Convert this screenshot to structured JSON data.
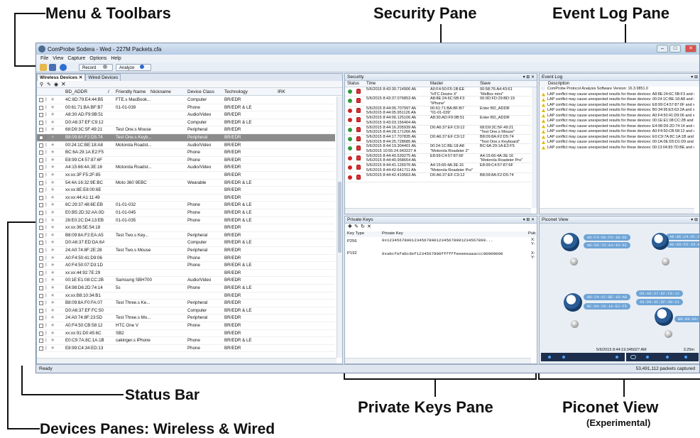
{
  "callouts": {
    "menu": "Menu & Toolbars",
    "security": "Security Pane",
    "eventlog": "Event Log Pane",
    "status": "Status Bar",
    "privkeys": "Private Keys Pane",
    "piconet": "Piconet View",
    "piconet_sub": "(Experimental)",
    "devices": "Devices Panes: Wireless & Wired"
  },
  "window": {
    "title": "ComProbe Sodera - Wed - 227M Packets.cfa",
    "min": "–",
    "max": "□",
    "close": "✕"
  },
  "menu": [
    "File",
    "View",
    "Capture",
    "Options",
    "Help"
  ],
  "toolbar": {
    "record": "Record",
    "analyze": "Analyze"
  },
  "devices": {
    "tabs": [
      "Wireless Devices ✕",
      "Wired Devices"
    ],
    "columns": [
      "BD_ADDR",
      "/",
      "Friendly Name",
      "Nickname",
      "Device Class",
      "Technology",
      "IRK"
    ],
    "rows": [
      [
        "4C:8D:79:E4:44:B5",
        "FTE.s MacBook...",
        "Computer",
        "BR/EDR"
      ],
      [
        "00:61:71:BA:BF:B7",
        "01-01-039",
        "Phone",
        "BR/EDR & LE"
      ],
      [
        "A8:30:AD:F9:9B:51",
        "",
        "Audio/Video",
        "BR/EDR"
      ],
      [
        "D0:A6:37:EF:C9:12",
        "",
        "Computer",
        "BR/EDR & LE"
      ],
      [
        "68:D9:3C:5F:49:21",
        "Test One.s Mouse",
        "Peripheral",
        "BR/EDR"
      ],
      [
        "B8:09:8A:F2:D5:74",
        "Test One.s Keyb...",
        "Peripheral",
        "BR/EDR"
      ],
      [
        "00:24:1C:BE:18:A8",
        "Motorola Roadst...",
        "Audio/Video",
        "BR/EDR"
      ],
      [
        "BC:6A:29:1A:E2:F5",
        "",
        "Phone",
        "BR/EDR"
      ],
      [
        "E8:99:C4:57:87:6F",
        "",
        "Phone",
        "BR/EDR"
      ],
      [
        "A4:15:66:4A:3E:16",
        "Motorola Roadst...",
        "Audio/Video",
        "BR/EDR"
      ],
      [
        "xx:xx:3F:F5:2F:85",
        "",
        "",
        "BR/EDR"
      ],
      [
        "54:4A:16:32:9E:BC",
        "Moto 360 9EBC",
        "Wearable",
        "BR/EDR & LE"
      ],
      [
        "xx:xx:8E:E8:00:6E",
        "",
        "",
        "BR/EDR"
      ],
      [
        "xx:xx:44:A1:11:49",
        "",
        "",
        "BR/EDR"
      ],
      [
        "8C:29:37:48:6E:EB",
        "01-01-032",
        "Phone",
        "BR/EDR & LE"
      ],
      [
        "E0:B5:2D:32:AA:0D",
        "01-01-045",
        "Phone",
        "BR/EDR & LE"
      ],
      [
        "28:E0:2C:D4:13:EB",
        "01-01-035",
        "Phone",
        "BR/EDR & LE"
      ],
      [
        "xx:xx:36:5E:54:18",
        "",
        "",
        "BR/EDR"
      ],
      [
        "B8:09:8A:F2:EA:A5",
        "Test Two.s Key...",
        "Peripheral",
        "BR/EDR"
      ],
      [
        "D0:A6:37:ED:DA:6A",
        "",
        "Computer",
        "BR/EDR & LE"
      ],
      [
        "24:A0:74:8F:2E:28",
        "Test Two.s Mouse",
        "Peripheral",
        "BR/EDR"
      ],
      [
        "A0:F4:50:41:D9:06",
        "",
        "Phone",
        "BR/EDR"
      ],
      [
        "A0:F4:50:07:D3:1D",
        "",
        "Phone",
        "BR/EDR & LE"
      ],
      [
        "xx:xx:44:92:7E:29",
        "",
        "",
        "BR/EDR"
      ],
      [
        "00:1E:E1:08:CC:2B",
        "Samsung SBH700",
        "Audio/Video",
        "BR/EDR"
      ],
      [
        "E4:98:D6:2D:74:14",
        "5s",
        "Phone",
        "BR/EDR & LE"
      ],
      [
        "xx:xx:B8:10:34:B1",
        "",
        "",
        "BR/EDR"
      ],
      [
        "B8:09:8A:F0:FA:07",
        "Test Three.s Ke...",
        "Peripheral",
        "BR/EDR"
      ],
      [
        "D0:A6:37:EF:FC:50",
        "",
        "Computer",
        "BR/EDR & LE"
      ],
      [
        "24:A0:74:8F:23:5D",
        "Test Three.s Mo...",
        "Peripheral",
        "BR/EDR"
      ],
      [
        "A0:F4:50:CB:58:12",
        "HTC One V",
        "Phone",
        "BR/EDR"
      ],
      [
        "xx:xx:91:D0:45:6C",
        "SB2",
        "",
        "BR/EDR"
      ],
      [
        "E0:C9:7A:8C:1A:1B",
        "cakinger.s iPhone",
        "Phone",
        "BR/EDR & LE"
      ],
      [
        "E8:99:C4:34:ED:13",
        "",
        "Phone",
        "BR/EDR"
      ]
    ]
  },
  "security": {
    "title": "Security",
    "columns": [
      "Status",
      "Time",
      "Master",
      "Slave"
    ],
    "rows": [
      [
        "5/6/2015 8:43:30.714906 AM",
        "",
        "A0:F4:50:F5:1B:EE",
        "\"HTC Desire X\"",
        "00:58:76:A4:43:61",
        "\"MsBox mini\""
      ],
      [
        "5/6/2015 8:43:37.076853 AM",
        "",
        "A8:8E:24:6C:5B:F3",
        "\"iPhone\"",
        "00:0D:FD:29:BD:19",
        ""
      ],
      [
        "5/6/2015 8:44:05.707997 AM",
        "5/6/2015 8:44:05.951126 AM",
        "00:61:71:BA:BF:B7",
        "\"01-01-039\"",
        "Enter BD_ADDR",
        ""
      ],
      [
        "5/6/2015 8:44:06.125106 AM",
        "5/6/2015 9:43:03.156404 AM",
        "A8:30:AD:F9:9B:51",
        "",
        "Enter BD_ADDR",
        ""
      ],
      [
        "5/6/2015 8:44:16.205939 AM",
        "5/6/2015 8:44:28.171266 AM",
        "D0:A6:37:EF:C9:12",
        "",
        "68:D9:3C:5F:49:21",
        "\"Test One.s Mouse\""
      ],
      [
        "5/6/2015 8:44:17.707835 AM",
        "5/6/2015 8:44:25.728685 AM",
        "D0:A6:37:EF:C9:12",
        "",
        "B8:09:8A:F2:D5:74",
        "\"Test One.s Keyboard\""
      ],
      [
        "5/6/2015 8:44:19.304401 AM",
        "5/6/2015 10:55:24.943227 AM",
        "00:24:1C:BE:18:A8",
        "\"Motorola Roadster 2\"",
        "BC:6A:29:1A:E2:F5",
        ""
      ],
      [
        "5/6/2015 8:44:40.539275 AM",
        "5/6/2015 8:44:40.958654 AM",
        "E8:99:C4:57:87:6F",
        "",
        "A4:15:66:4A:3E:16",
        "\"Motorola Roadster Pro\""
      ],
      [
        "5/6/2015 8:44:41.126076 AM",
        "5/6/2015 8:44:42.641711 AM",
        "A4:15:66:4A:3E:16",
        "\"Motorola Roadster Pro\"",
        "E8:99:C4:57:87:6F",
        ""
      ],
      [
        "5/6/2015 8:44:42.419563 AM",
        "",
        "D0:A6:37:EF:C9:12",
        "",
        "B8:09:8A:F2:D5:74",
        ""
      ]
    ]
  },
  "eventlog": {
    "title": "Event Log",
    "column": "Description",
    "version": "ComProbe Protocol Analysis Software Version: 16.3.9851.0",
    "prefix": "LAP conflict may cause unexpected results for these devices: ",
    "items": [
      "A8:8E:24:6C:5B:F3 and xx:xx",
      "00:24:1C:BE:18:A8 and xx:xx",
      "E8:99:C4:57:87:6F and xx:xx",
      "B0:34:95:E5:63:2A and xx:xx",
      "A0:F4:50:41:D9:06 and xx:xx",
      "00:1E:E1:08:CC:2B and xx:xx",
      "E4:98:D6:2D:74:14 and xx:xx",
      "A0:F4:50:CB:58:12 and xx:xx",
      "E0:C9:7A:8C:1A:1B and xx:xx",
      "00:1A:0E:D5:D1:D9 and xx:xx",
      "00:13:04:83:7D:BE and xx:xx"
    ]
  },
  "privkeys": {
    "title": "Private Keys",
    "columns": [
      "Key Type",
      "Private Key",
      "Pub"
    ],
    "rows": [
      [
        "P256",
        "0x1234567890123456789012345678901234567890...",
        "X:",
        "Y:"
      ],
      [
        "P192",
        "0xabcfefabcdef1234567890ffffffeeeeeaaaccc00000000",
        "X:",
        "Y:"
      ]
    ]
  },
  "piconet": {
    "title": "Piconet View",
    "labels": [
      "A0:F4:50:F5:1B:EE",
      "00:58:76:A4:43:61",
      "A8:8E:24:6C:5B",
      "00:0D:FD:29:B",
      "00:24:1C:BE:18:A8",
      "BC:6A:29:1A:E2:F5",
      "D0:A6:37:EF:C9:12",
      "68:D9:3C:5F:49:21",
      "B8:09:8A:F2:D"
    ],
    "timeline_time": "5/6/2015 8:44:19.045027 AM",
    "timeline_right": "3.25m"
  },
  "status": {
    "left": "Ready",
    "right": "53,491,112 packets captured"
  }
}
